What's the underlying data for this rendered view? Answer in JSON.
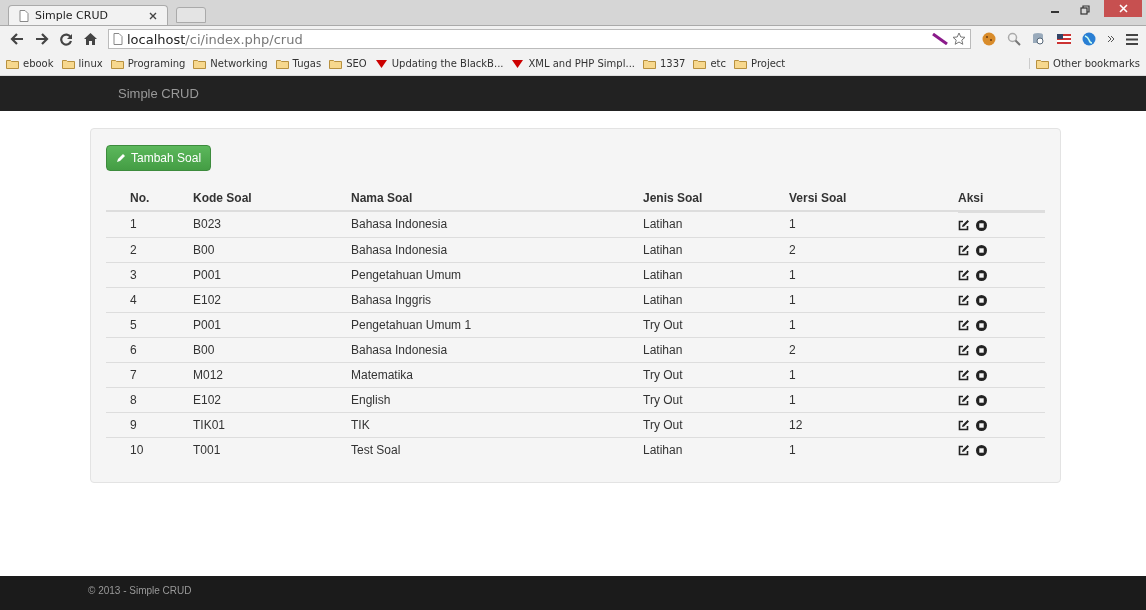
{
  "browser": {
    "tab_title": "Simple CRUD",
    "url_host": "localhost",
    "url_path": "/ci/index.php/crud",
    "bookmarks": [
      {
        "label": "ebook",
        "kind": "folder"
      },
      {
        "label": "linux",
        "kind": "folder"
      },
      {
        "label": "Programing",
        "kind": "folder"
      },
      {
        "label": "Networking",
        "kind": "folder"
      },
      {
        "label": "Tugas",
        "kind": "folder"
      },
      {
        "label": "SEO",
        "kind": "folder"
      },
      {
        "label": "Updating the BlackB...",
        "kind": "page"
      },
      {
        "label": "XML and PHP Simpl...",
        "kind": "page"
      },
      {
        "label": "1337",
        "kind": "folder"
      },
      {
        "label": "etc",
        "kind": "folder"
      },
      {
        "label": "Project",
        "kind": "folder"
      }
    ],
    "other_bookmarks": "Other bookmarks"
  },
  "navbar": {
    "brand": "Simple CRUD"
  },
  "add_button": "Tambah Soal",
  "table": {
    "columns": [
      "No.",
      "Kode Soal",
      "Nama Soal",
      "Jenis Soal",
      "Versi Soal",
      "Aksi"
    ],
    "rows": [
      [
        "1",
        "B023",
        "Bahasa Indonesia",
        "Latihan",
        "1"
      ],
      [
        "2",
        "B00",
        "Bahasa Indonesia",
        "Latihan",
        "2"
      ],
      [
        "3",
        "P001",
        "Pengetahuan Umum",
        "Latihan",
        "1"
      ],
      [
        "4",
        "E102",
        "Bahasa Inggris",
        "Latihan",
        "1"
      ],
      [
        "5",
        "P001",
        "Pengetahuan Umum 1",
        "Try Out",
        "1"
      ],
      [
        "6",
        "B00",
        "Bahasa Indonesia",
        "Latihan",
        "2"
      ],
      [
        "7",
        "M012",
        "Matematika",
        "Try Out",
        "1"
      ],
      [
        "8",
        "E102",
        "English",
        "Try Out",
        "1"
      ],
      [
        "9",
        "TIK01",
        "TIK",
        "Try Out",
        "12"
      ],
      [
        "10",
        "T001",
        "Test Soal",
        "Latihan",
        "1"
      ]
    ]
  },
  "footer": "© 2013 - Simple CRUD"
}
